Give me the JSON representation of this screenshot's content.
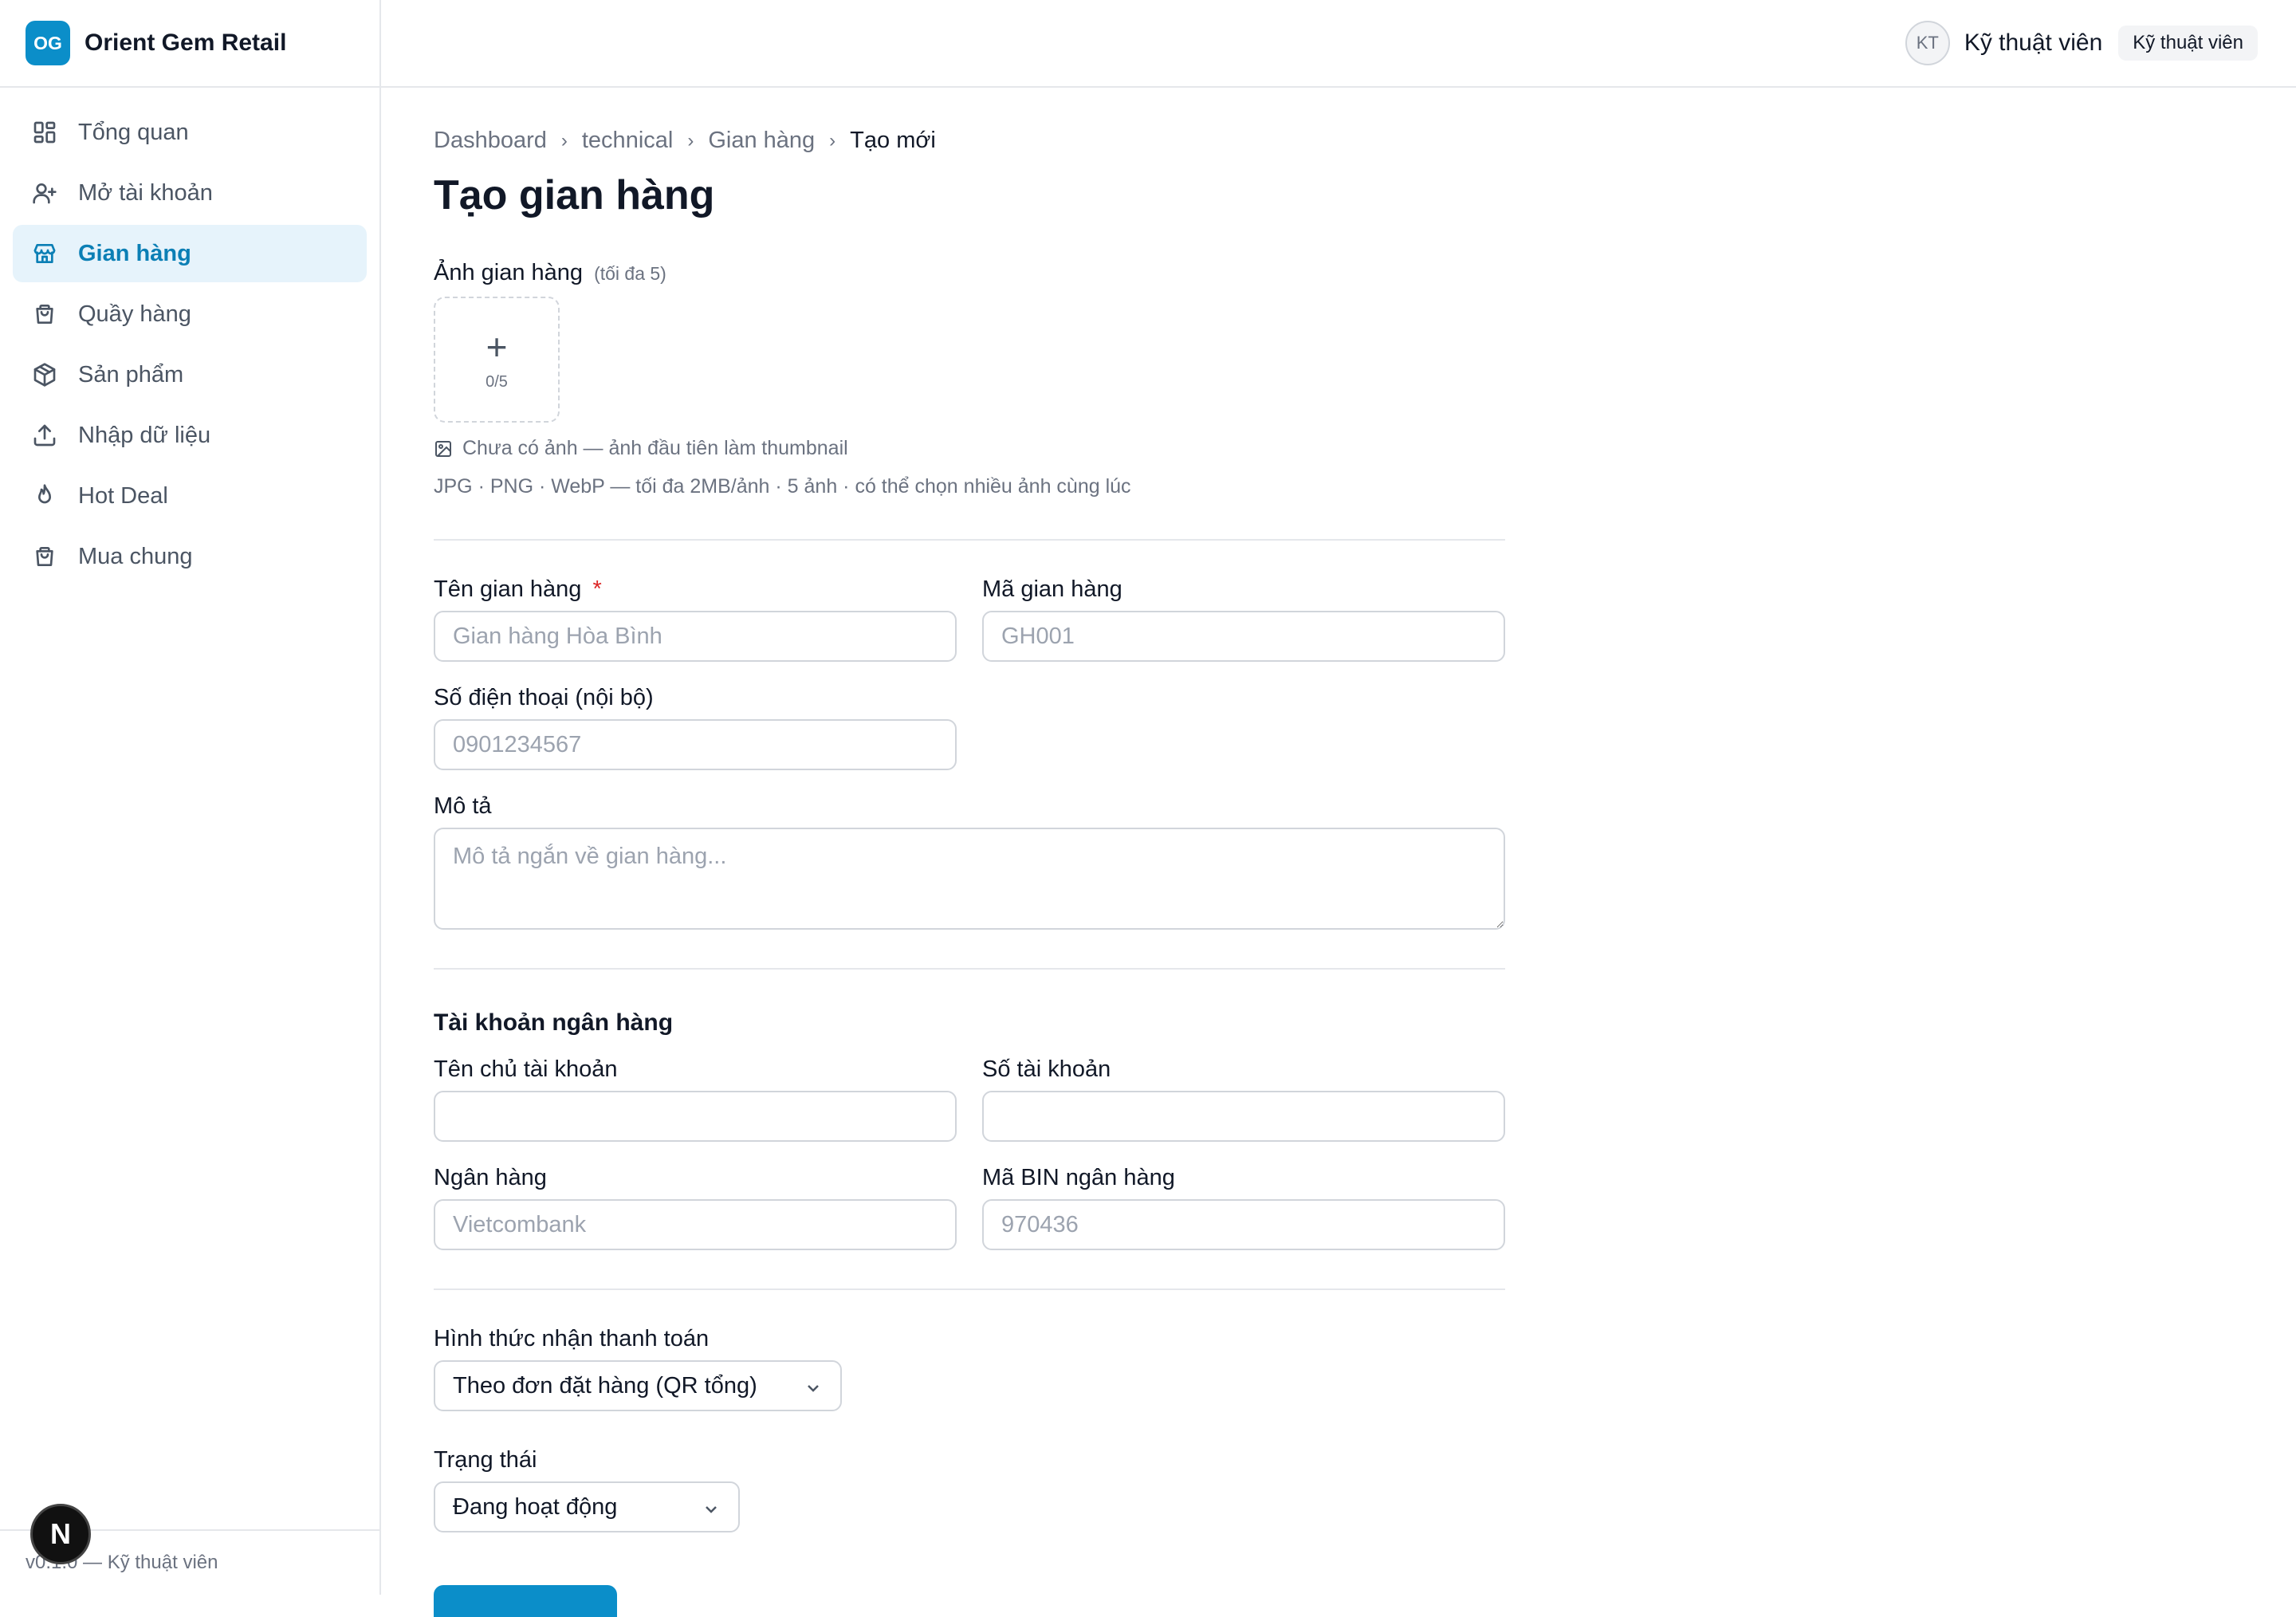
{
  "brand": {
    "logo_text": "OG",
    "name": "Orient Gem Retail"
  },
  "sidebar": {
    "items": [
      {
        "label": "Tổng quan",
        "icon": "dashboard-icon",
        "active": false
      },
      {
        "label": "Mở tài khoản",
        "icon": "user-plus-icon",
        "active": false
      },
      {
        "label": "Gian hàng",
        "icon": "store-icon",
        "active": true
      },
      {
        "label": "Quầy hàng",
        "icon": "shopping-bag-icon",
        "active": false
      },
      {
        "label": "Sản phẩm",
        "icon": "package-icon",
        "active": false
      },
      {
        "label": "Nhập dữ liệu",
        "icon": "upload-icon",
        "active": false
      },
      {
        "label": "Hot Deal",
        "icon": "flame-icon",
        "active": false
      },
      {
        "label": "Mua chung",
        "icon": "shopping-bag-icon",
        "active": false
      }
    ],
    "footer": "v0.1.0 — Kỹ thuật viên",
    "dev_badge": "N"
  },
  "header": {
    "avatar_initials": "KT",
    "user_name": "Kỹ thuật viên",
    "role": "Kỹ thuật viên"
  },
  "breadcrumb": [
    "Dashboard",
    "technical",
    "Gian hàng",
    "Tạo mới"
  ],
  "page_title": "Tạo gian hàng",
  "images": {
    "label": "Ảnh gian hàng",
    "limit_hint": "(tối đa 5)",
    "count": "0/5",
    "empty_note": "Chưa có ảnh — ảnh đầu tiên làm thumbnail",
    "format_note": "JPG · PNG · WebP — tối đa 2MB/ảnh · 5 ảnh · có thể chọn nhiều ảnh cùng lúc"
  },
  "form": {
    "name": {
      "label": "Tên gian hàng",
      "required_mark": "*",
      "placeholder": "Gian hàng Hòa Bình",
      "value": ""
    },
    "code": {
      "label": "Mã gian hàng",
      "placeholder": "GH001",
      "value": ""
    },
    "phone": {
      "label": "Số điện thoại (nội bộ)",
      "placeholder": "0901234567",
      "value": ""
    },
    "description": {
      "label": "Mô tả",
      "placeholder": "Mô tả ngắn về gian hàng...",
      "value": ""
    }
  },
  "bank": {
    "section_title": "Tài khoản ngân hàng",
    "holder": {
      "label": "Tên chủ tài khoản",
      "placeholder": "",
      "value": ""
    },
    "account": {
      "label": "Số tài khoản",
      "placeholder": "",
      "value": ""
    },
    "bank_name": {
      "label": "Ngân hàng",
      "placeholder": "Vietcombank",
      "value": ""
    },
    "bin": {
      "label": "Mã BIN ngân hàng",
      "placeholder": "970436",
      "value": ""
    }
  },
  "payment": {
    "label": "Hình thức nhận thanh toán",
    "selected": "Theo đơn đặt hàng (QR tổng)"
  },
  "status": {
    "label": "Trạng thái",
    "selected": "Đang hoạt động"
  },
  "colors": {
    "accent": "#0b8ec9",
    "active_bg": "#e6f3fb",
    "required": "#dc2626"
  }
}
